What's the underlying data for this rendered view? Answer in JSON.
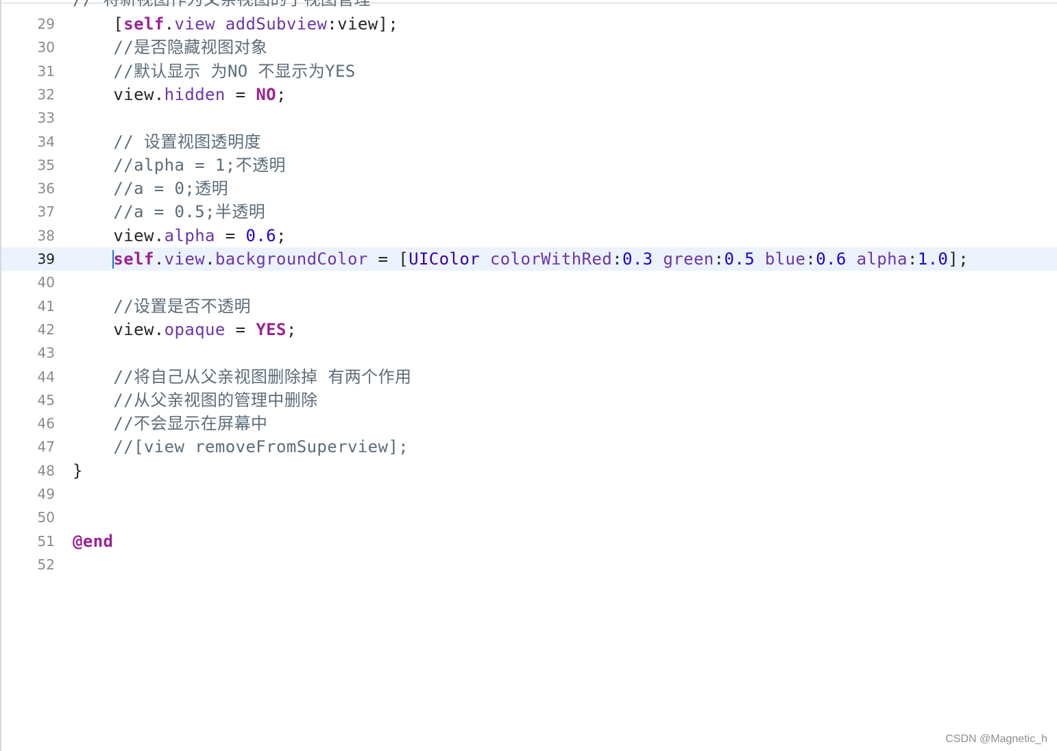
{
  "editor": {
    "partial_top_line": "// 将新视图作为父亲视图的子视图管理",
    "lines": [
      {
        "num": "29",
        "indent": "    ",
        "segments": [
          [
            "plain",
            "["
          ],
          [
            "kw",
            "self"
          ],
          [
            "plain",
            "."
          ],
          [
            "prop",
            "view"
          ],
          [
            "plain",
            " "
          ],
          [
            "prop",
            "addSubview"
          ],
          [
            "plain",
            ":view];"
          ]
        ]
      },
      {
        "num": "30",
        "indent": "    ",
        "segments": [
          [
            "comment",
            "//是否隐藏视图对象"
          ]
        ]
      },
      {
        "num": "31",
        "indent": "    ",
        "segments": [
          [
            "comment",
            "//默认显示 为NO 不显示为YES"
          ]
        ]
      },
      {
        "num": "32",
        "indent": "    ",
        "segments": [
          [
            "plain",
            "view."
          ],
          [
            "prop",
            "hidden"
          ],
          [
            "plain",
            " = "
          ],
          [
            "kw",
            "NO"
          ],
          [
            "plain",
            ";"
          ]
        ]
      },
      {
        "num": "33",
        "indent": "",
        "segments": []
      },
      {
        "num": "34",
        "indent": "    ",
        "segments": [
          [
            "comment",
            "// 设置视图透明度"
          ]
        ]
      },
      {
        "num": "35",
        "indent": "    ",
        "segments": [
          [
            "comment",
            "//alpha = 1;不透明"
          ]
        ]
      },
      {
        "num": "36",
        "indent": "    ",
        "segments": [
          [
            "comment",
            "//a = 0;透明"
          ]
        ]
      },
      {
        "num": "37",
        "indent": "    ",
        "segments": [
          [
            "comment",
            "//a = 0.5;半透明"
          ]
        ]
      },
      {
        "num": "38",
        "indent": "    ",
        "segments": [
          [
            "plain",
            "view."
          ],
          [
            "prop",
            "alpha"
          ],
          [
            "plain",
            " = "
          ],
          [
            "num",
            "0.6"
          ],
          [
            "plain",
            ";"
          ]
        ]
      },
      {
        "num": "39",
        "indent": "    ",
        "current": true,
        "segments": [
          [
            "kw",
            "self"
          ],
          [
            "plain",
            "."
          ],
          [
            "prop",
            "view"
          ],
          [
            "plain",
            "."
          ],
          [
            "prop",
            "backgroundColor"
          ],
          [
            "plain",
            " = ["
          ],
          [
            "cls",
            "UIColor"
          ],
          [
            "plain",
            " "
          ],
          [
            "prop",
            "colorWithRed"
          ],
          [
            "plain",
            ":"
          ],
          [
            "num",
            "0.3"
          ],
          [
            "plain",
            " "
          ],
          [
            "prop",
            "green"
          ],
          [
            "plain",
            ":"
          ],
          [
            "num",
            "0.5"
          ],
          [
            "plain",
            " "
          ],
          [
            "prop",
            "blue"
          ],
          [
            "plain",
            ":"
          ],
          [
            "num",
            "0.6"
          ],
          [
            "plain",
            " "
          ],
          [
            "prop",
            "alpha"
          ],
          [
            "plain",
            ":"
          ],
          [
            "num",
            "1.0"
          ],
          [
            "plain",
            "];"
          ]
        ]
      },
      {
        "num": "40",
        "indent": "",
        "segments": []
      },
      {
        "num": "41",
        "indent": "    ",
        "segments": [
          [
            "comment",
            "//设置是否不透明"
          ]
        ]
      },
      {
        "num": "42",
        "indent": "    ",
        "segments": [
          [
            "plain",
            "view."
          ],
          [
            "prop",
            "opaque"
          ],
          [
            "plain",
            " = "
          ],
          [
            "kw",
            "YES"
          ],
          [
            "plain",
            ";"
          ]
        ]
      },
      {
        "num": "43",
        "indent": "",
        "segments": []
      },
      {
        "num": "44",
        "indent": "    ",
        "segments": [
          [
            "comment",
            "//将自己从父亲视图删除掉 有两个作用"
          ]
        ]
      },
      {
        "num": "45",
        "indent": "    ",
        "segments": [
          [
            "comment",
            "//从父亲视图的管理中删除"
          ]
        ]
      },
      {
        "num": "46",
        "indent": "    ",
        "segments": [
          [
            "comment",
            "//不会显示在屏幕中"
          ]
        ]
      },
      {
        "num": "47",
        "indent": "    ",
        "segments": [
          [
            "comment",
            "//[view removeFromSuperview];"
          ]
        ]
      },
      {
        "num": "48",
        "indent": "",
        "segments": [
          [
            "plain",
            "}"
          ]
        ]
      },
      {
        "num": "49",
        "indent": "",
        "segments": []
      },
      {
        "num": "50",
        "indent": "",
        "segments": []
      },
      {
        "num": "51",
        "indent": "",
        "segments": [
          [
            "kw",
            "@end"
          ]
        ]
      },
      {
        "num": "52",
        "indent": "",
        "segments": []
      }
    ]
  },
  "watermark": "CSDN @Magnetic_h",
  "colors": {
    "keyword": "#9b2393",
    "property": "#6c36a9",
    "class": "#3900a0",
    "number": "#1c00cf",
    "comment": "#5d6c79",
    "current_line": "#ecf3fd",
    "cursor": "#1a73e8"
  }
}
